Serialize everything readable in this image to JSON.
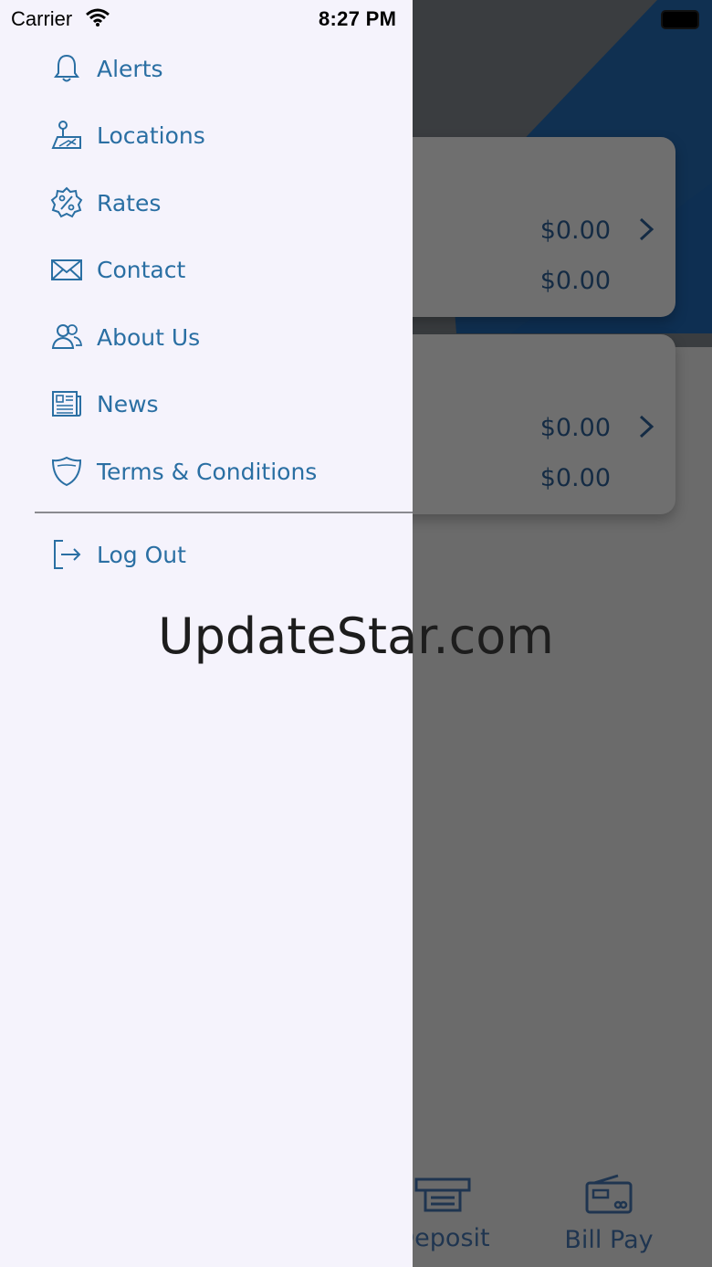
{
  "status_bar": {
    "carrier": "Carrier",
    "time": "8:27 PM"
  },
  "menu": {
    "items": [
      {
        "label": "Alerts",
        "icon": "bell-icon"
      },
      {
        "label": "Locations",
        "icon": "map-location-icon"
      },
      {
        "label": "Rates",
        "icon": "percent-badge-icon"
      },
      {
        "label": "Contact",
        "icon": "envelope-icon"
      },
      {
        "label": "About Us",
        "icon": "people-icon"
      },
      {
        "label": "News",
        "icon": "newspaper-icon"
      },
      {
        "label": "Terms & Conditions",
        "icon": "shield-icon"
      }
    ],
    "logout": {
      "label": "Log Out",
      "icon": "logout-icon"
    }
  },
  "accounts": [
    {
      "amount_primary": "$0.00",
      "amount_secondary": "$0.00"
    },
    {
      "amount_primary": "$0.00",
      "amount_secondary": "$0.00"
    }
  ],
  "tab_bar": {
    "deposit_label": "Deposit",
    "billpay_label": "Bill Pay"
  },
  "watermark": "UpdateStar.com",
  "colors": {
    "accent": "#2a6fa3",
    "drawer_bg": "#f5f3fc",
    "brand_dark": "#0e2f52"
  }
}
